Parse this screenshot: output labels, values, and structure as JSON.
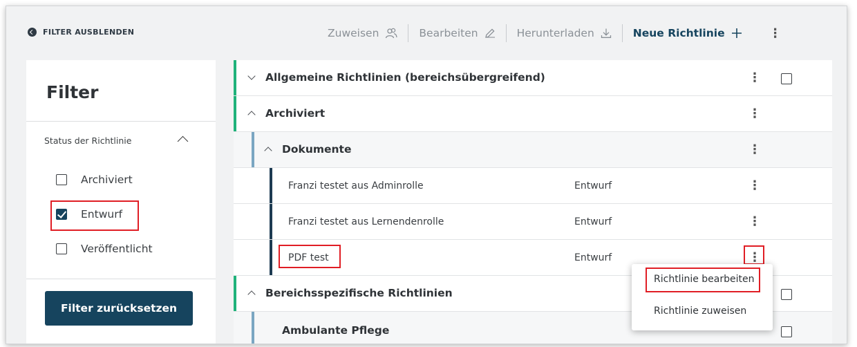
{
  "topbar": {
    "hide_filter_label": "FILTER AUSBLENDEN",
    "actions": [
      {
        "label": "Zuweisen",
        "icon": "users-icon"
      },
      {
        "label": "Bearbeiten",
        "icon": "pencil-icon"
      },
      {
        "label": "Herunterladen",
        "icon": "download-icon"
      },
      {
        "label": "Neue Richtlinie",
        "icon": "plus-icon"
      }
    ]
  },
  "filter": {
    "title": "Filter",
    "status_heading": "Status der Richtlinie",
    "options": [
      {
        "label": "Archiviert",
        "checked": false
      },
      {
        "label": "Entwurf",
        "checked": true
      },
      {
        "label": "Veröffentlicht",
        "checked": false
      }
    ],
    "reset_label": "Filter zurücksetzen"
  },
  "tree": {
    "group_general": "Allgemeine Richtlinien (bereichsübergreifend)",
    "group_archived": "Archiviert",
    "folder_documents": "Dokumente",
    "documents": [
      {
        "name": "Franzi testet aus Adminrolle",
        "status": "Entwurf"
      },
      {
        "name": "Franzi testet aus Lernendenrolle",
        "status": "Entwurf"
      },
      {
        "name": "PDF test",
        "status": "Entwurf"
      }
    ],
    "group_specific": "Bereichsspezifische Richtlinien",
    "sub_ambulant": "Ambulante Pflege"
  },
  "context_menu": {
    "edit": "Richtlinie bearbeiten",
    "assign": "Richtlinie zuweisen"
  },
  "colors": {
    "primary": "#16445e",
    "accent_green": "#1fb27a",
    "accent_blue": "#7aa6c2",
    "dark_bar": "#1d3b52",
    "highlight_red": "#e01d24"
  }
}
